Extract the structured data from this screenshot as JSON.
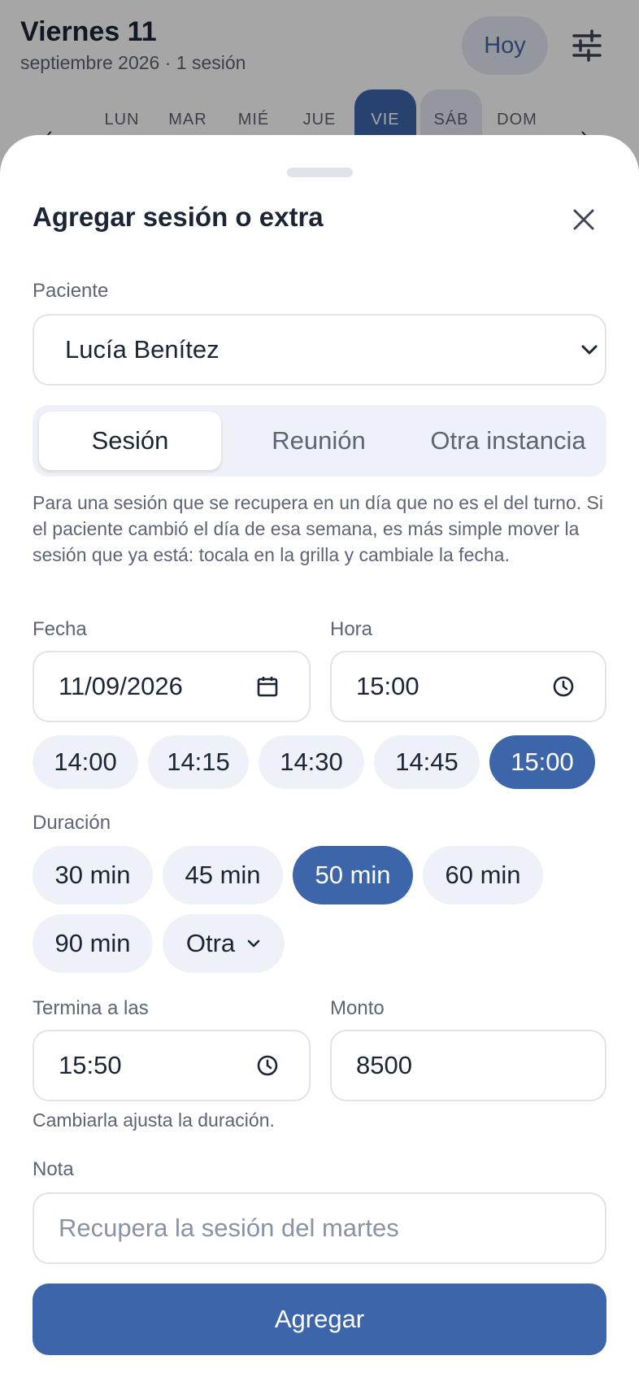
{
  "background": {
    "title": "Viernes 11",
    "subtitle": "septiembre 2026 · 1 sesión",
    "today_button": "Hoy",
    "week_days": [
      "LUN",
      "MAR",
      "MIÉ",
      "JUE",
      "VIE",
      "SÁB",
      "DOM"
    ],
    "selected_day": "VIE"
  },
  "sheet": {
    "title": "Agregar sesión o extra",
    "patient_label": "Paciente",
    "patient_value": "Lucía Benítez",
    "tabs": [
      {
        "label": "Sesión",
        "active": true
      },
      {
        "label": "Reunión",
        "active": false
      },
      {
        "label": "Otra instancia",
        "active": false
      }
    ],
    "help_text": "Para una sesión que se recupera en un día que no es el del turno. Si el paciente cambió el día de esa semana, es más simple mover la sesión que ya está: tocala en la grilla y cambiale la fecha.",
    "date_label": "Fecha",
    "date_value": "11/09/2026",
    "time_label": "Hora",
    "time_value": "15:00",
    "time_chips": [
      {
        "label": "14:00",
        "active": false
      },
      {
        "label": "14:15",
        "active": false
      },
      {
        "label": "14:30",
        "active": false
      },
      {
        "label": "14:45",
        "active": false
      },
      {
        "label": "15:00",
        "active": true
      }
    ],
    "duration_label": "Duración",
    "duration_chips": [
      {
        "label": "30 min",
        "active": false
      },
      {
        "label": "45 min",
        "active": false
      },
      {
        "label": "50 min",
        "active": true
      },
      {
        "label": "60 min",
        "active": false
      },
      {
        "label": "90 min",
        "active": false
      }
    ],
    "other_duration_label": "Otra",
    "end_label": "Termina a las",
    "end_value": "15:50",
    "end_hint": "Cambiarla ajusta la duración.",
    "amount_label": "Monto",
    "amount_value": "8500",
    "note_label": "Nota",
    "note_placeholder": "Recupera la sesión del martes",
    "submit_label": "Agregar"
  },
  "colors": {
    "accent": "#3d66aa",
    "chip_bg": "#eef1f7",
    "text": "#1c2536",
    "muted": "#5b6575"
  }
}
